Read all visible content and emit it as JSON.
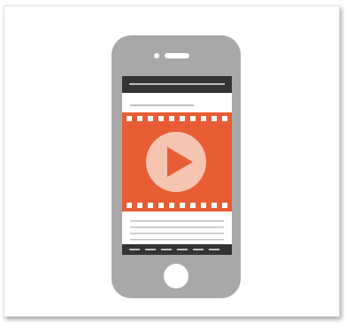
{
  "illustration": {
    "subject": "smartphone-video-player",
    "icon": "play-icon",
    "colors": {
      "phone_body": "#a8a8a8",
      "phone_dark_bar": "#333333",
      "screen_bg": "#ffffff",
      "video_bg": "#e85d33",
      "play_circle": "#f6c5b2",
      "play_triangle": "#e85d33",
      "text_lines": "#bfbfbf",
      "home_button": "#ffffff"
    }
  }
}
